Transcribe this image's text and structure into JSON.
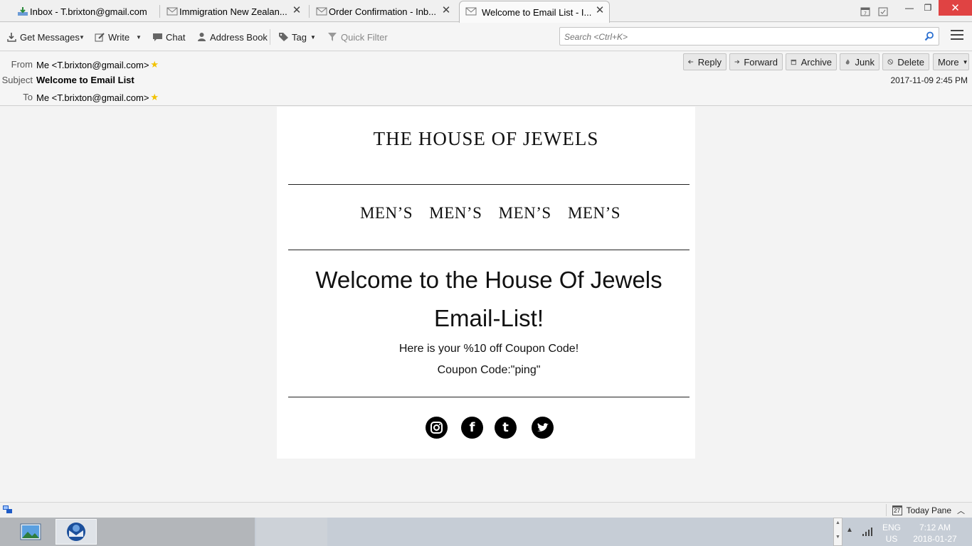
{
  "tabs": [
    {
      "label": "Inbox - T.brixton@gmail.com",
      "icon": "inbox-download-icon",
      "active": false,
      "closable": false
    },
    {
      "label": "Immigration New Zealan...",
      "icon": "envelope-icon",
      "active": false,
      "closable": true
    },
    {
      "label": "Order Confirmation - Inb...",
      "icon": "envelope-icon",
      "active": false,
      "closable": true
    },
    {
      "label": "Welcome to Email List - I...",
      "icon": "envelope-icon",
      "active": true,
      "closable": true
    }
  ],
  "toolbar": {
    "get_messages": "Get Messages",
    "write": "Write",
    "chat": "Chat",
    "address_book": "Address Book",
    "tag": "Tag",
    "quick_filter": "Quick Filter",
    "search_placeholder": "Search <Ctrl+K>"
  },
  "header": {
    "from_label": "From",
    "from_value": "Me <T.brixton@gmail.com>",
    "subject_label": "Subject",
    "subject_value": "Welcome to Email List",
    "to_label": "To",
    "to_value": "Me <T.brixton@gmail.com>",
    "date": "2017-11-09 2:45 PM",
    "buttons": {
      "reply": "Reply",
      "forward": "Forward",
      "archive": "Archive",
      "junk": "Junk",
      "delete": "Delete",
      "more": "More"
    }
  },
  "email": {
    "brand": "THE HOUSE OF JEWELS",
    "nav": [
      "MEN’S",
      "MEN’S",
      "MEN’S",
      "MEN’S"
    ],
    "welcome_line1": "Welcome to the House Of Jewels",
    "welcome_line2": "Email-List!",
    "coupon_line": "Here is your %10 off Coupon Code!",
    "coupon_code": "Coupon Code:\"ping\"",
    "social": [
      "instagram-icon",
      "facebook-icon",
      "tumblr-icon",
      "twitter-icon"
    ]
  },
  "statusbar": {
    "today_pane": "Today Pane",
    "calendar_day": "27"
  },
  "taskbar": {
    "lang": "ENG",
    "region": "US",
    "time": "7:12 AM",
    "date": "2018-01-27"
  },
  "colors": {
    "close_red": "#e04343",
    "star_gold": "#f2c200",
    "taskbar": "#c6cdd6"
  }
}
